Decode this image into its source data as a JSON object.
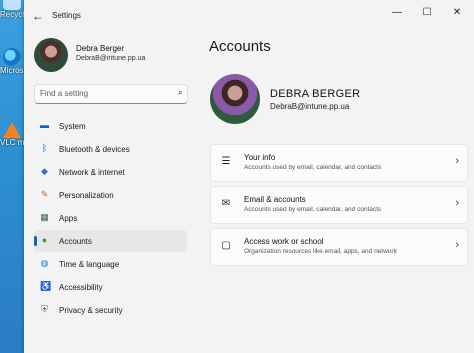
{
  "desktop": {
    "icons": [
      {
        "label": "Recycle",
        "icon": "recycle-bin-icon"
      },
      {
        "label": "Micros Edg",
        "icon": "edge-icon"
      },
      {
        "label": "VLC m play",
        "icon": "vlc-icon"
      }
    ]
  },
  "window": {
    "title": "Settings",
    "controls": {
      "minimize": "—",
      "maximize": "☐",
      "close": "✕"
    }
  },
  "profile": {
    "name": "Debra Berger",
    "email": "DebraB@intune.pp.ua"
  },
  "search": {
    "placeholder": "Find a setting"
  },
  "nav": {
    "items": [
      {
        "label": "System",
        "icon": "monitor-icon",
        "color": "#0a64c8"
      },
      {
        "label": "Bluetooth & devices",
        "icon": "bluetooth-icon",
        "color": "#0a64c8"
      },
      {
        "label": "Network & internet",
        "icon": "wifi-icon",
        "color": "#2a6fdb"
      },
      {
        "label": "Personalization",
        "icon": "brush-icon",
        "color": "#c05a2b"
      },
      {
        "label": "Apps",
        "icon": "apps-icon",
        "color": "#455a64"
      },
      {
        "label": "Accounts",
        "icon": "person-icon",
        "color": "#2e9d5d"
      },
      {
        "label": "Time & language",
        "icon": "globe-clock-icon",
        "color": "#1f7bd0"
      },
      {
        "label": "Accessibility",
        "icon": "accessibility-icon",
        "color": "#1f7bd0"
      },
      {
        "label": "Privacy & security",
        "icon": "shield-icon",
        "color": "#5b6770"
      }
    ],
    "active_index": 5
  },
  "main": {
    "page_title": "Accounts",
    "hero_name": "DEBRA BERGER",
    "hero_email": "DebraB@intune.pp.ua",
    "cards": [
      {
        "title": "Your info",
        "subtitle": "Accounts used by email, calendar, and contacts",
        "icon": "contact-card-icon"
      },
      {
        "title": "Email & accounts",
        "subtitle": "Accounts used by email, calendar, and contacts",
        "icon": "mail-icon"
      },
      {
        "title": "Access work or school",
        "subtitle": "Organization resources like email, apps, and network",
        "icon": "briefcase-icon"
      }
    ]
  }
}
